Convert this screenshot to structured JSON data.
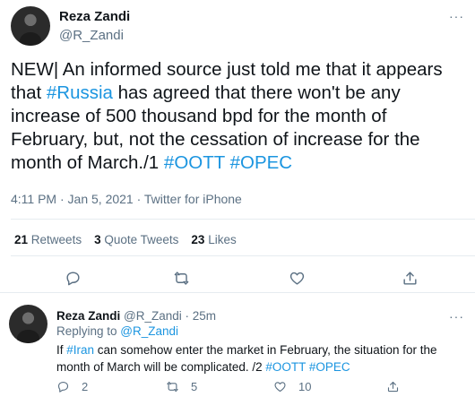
{
  "main_tweet": {
    "author_name": "Reza Zandi",
    "author_handle": "@R_Zandi",
    "text_parts": {
      "p1": "NEW| An informed source just told me that it appears that ",
      "h1": "#Russia",
      "p2": " has agreed that there won't be any increase of 500 thousand bpd for the month of February, but, not the cessation of increase for the month of March./1 ",
      "h2": "#OOTT",
      "p3": " ",
      "h3": "#OPEC"
    },
    "meta": "4:11 PM · Jan 5, 2021 · Twitter for iPhone",
    "stats": {
      "retweets_count": "21",
      "retweets_label": "Retweets",
      "quotes_count": "3",
      "quotes_label": "Quote Tweets",
      "likes_count": "23",
      "likes_label": "Likes"
    },
    "more_label": "···"
  },
  "reply_tweet": {
    "author_name": "Reza Zandi",
    "author_handle": "@R_Zandi",
    "dot": " · ",
    "age": "25m",
    "replying_prefix": "Replying to ",
    "replying_to": "@R_Zandi",
    "text_parts": {
      "p1": "If ",
      "h1": "#Iran",
      "p2": " can somehow enter the market in February, the situation for the month of March will be complicated. /2 ",
      "h2": "#OOTT",
      "p3": " ",
      "h3": "#OPEC"
    },
    "counts": {
      "replies": "2",
      "retweets": "5",
      "likes": "10"
    },
    "more_label": "···"
  },
  "colors": {
    "link": "#1b95e0",
    "muted": "#5b7083",
    "divider": "#e6ecf0"
  }
}
